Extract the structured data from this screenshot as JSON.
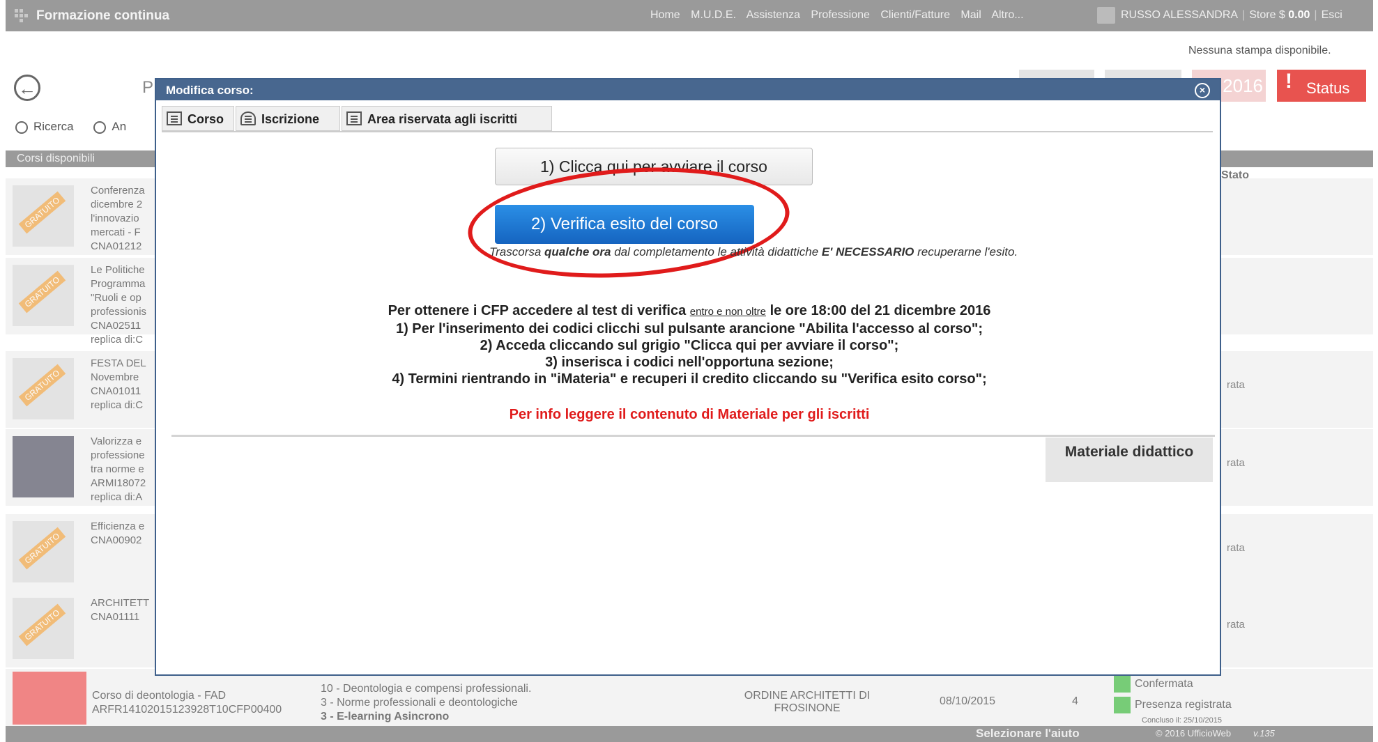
{
  "topbar": {
    "title": "Formazione continua",
    "nav": [
      "Home",
      "M.U.D.E.",
      "Assistenza",
      "Professione",
      "Clienti/Fatture",
      "Mail",
      "Altro..."
    ],
    "user": "RUSSO ALESSANDRA",
    "store_label": "Store $",
    "store_value": "0.00",
    "exit_label": "Esci"
  },
  "print_info": "Nessuna stampa disponibile.",
  "background": {
    "page_initial": "P",
    "year": "2016",
    "status_label": "Status",
    "search_label": "Ricerca",
    "search2_label": "An",
    "tab_label": "Corsi disponibili",
    "stato_header": "Stato",
    "rows": [
      {
        "text": "Conferenza\ndicembre 2\nl'innovazio\nmercati - F\nCNA01212",
        "stat": ""
      },
      {
        "text": "Le Politiche\nProgramma\n\"Ruoli e op\nprofessionis\nCNA02511\nreplica di:C",
        "stat": ""
      },
      {
        "text": "FESTA DEL\nNovembre\nCNA01011\nreplica di:C",
        "stat": "rata"
      },
      {
        "text": "Valorizza e\nprofessione\ntra norme e\nARMI18072\nreplica di:A",
        "stat": "rata"
      },
      {
        "text": "Efficienza e\nCNA00902",
        "stat": "rata"
      },
      {
        "text": "ARCHITETT\nCNA01111",
        "stat": "rata"
      }
    ],
    "foot": {
      "title": "Corso di deontologia - FAD",
      "code": "ARFR14102015123928T10CFP00400",
      "topics": [
        "10 - Deontologia e compensi professionali.",
        "3 - Norme professionali e deontologiche",
        "3 - E-learning Asincrono"
      ],
      "org": "ORDINE ARCHITETTI DI FROSINONE",
      "date": "08/10/2015",
      "credits": "4",
      "status1": "Confermata",
      "status2": "Presenza registrata",
      "extra": "Concluso il: 25/10/2015"
    },
    "bottom": {
      "help": "Selezionare l'aiuto",
      "copyright": "© 2016 UfficioWeb",
      "version": "v.135"
    }
  },
  "modal": {
    "title": "Modifica corso:",
    "tabs": [
      "Corso",
      "Iscrizione",
      "Area riservata agli iscritti"
    ],
    "btn_avvia": "1) Clicca qui per avviare il corso",
    "btn_verifica": "2) Verifica esito del corso",
    "note_prefix": "Trascorsa",
    "note_bold1": "qualche ora",
    "note_mid": "dal completamento le attività didattiche",
    "note_bold2": "E' NECESSARIO",
    "note_suffix": "recuperarne l'esito.",
    "instr_line1_a": "Per  ottenere i CFP accedere al test di verifica",
    "instr_line1_u": "entro e non oltre",
    "instr_line1_b": "le ore 18:00 del 21 dicembre 2016",
    "instr_lines": [
      "1) Per l'inserimento dei codici clicchi sul pulsante arancione \"Abilita l'accesso al corso\";",
      "2) Acceda cliccando sul grigio \"Clicca qui per avviare il corso\";",
      "3) inserisca i codici nell'opportuna sezione;",
      "4) Termini rientrando in \"iMateria\" e recuperi il credito cliccando su \"Verifica esito corso\";"
    ],
    "info_red": "Per info leggere il contenuto di Materiale per gli iscritti",
    "material_label": "Materiale didattico"
  },
  "colors": {
    "modal_header": "#48678f",
    "verify_button": "#1a72d0",
    "highlight_ring": "#e01b1b",
    "status_button": "#e8534f"
  }
}
